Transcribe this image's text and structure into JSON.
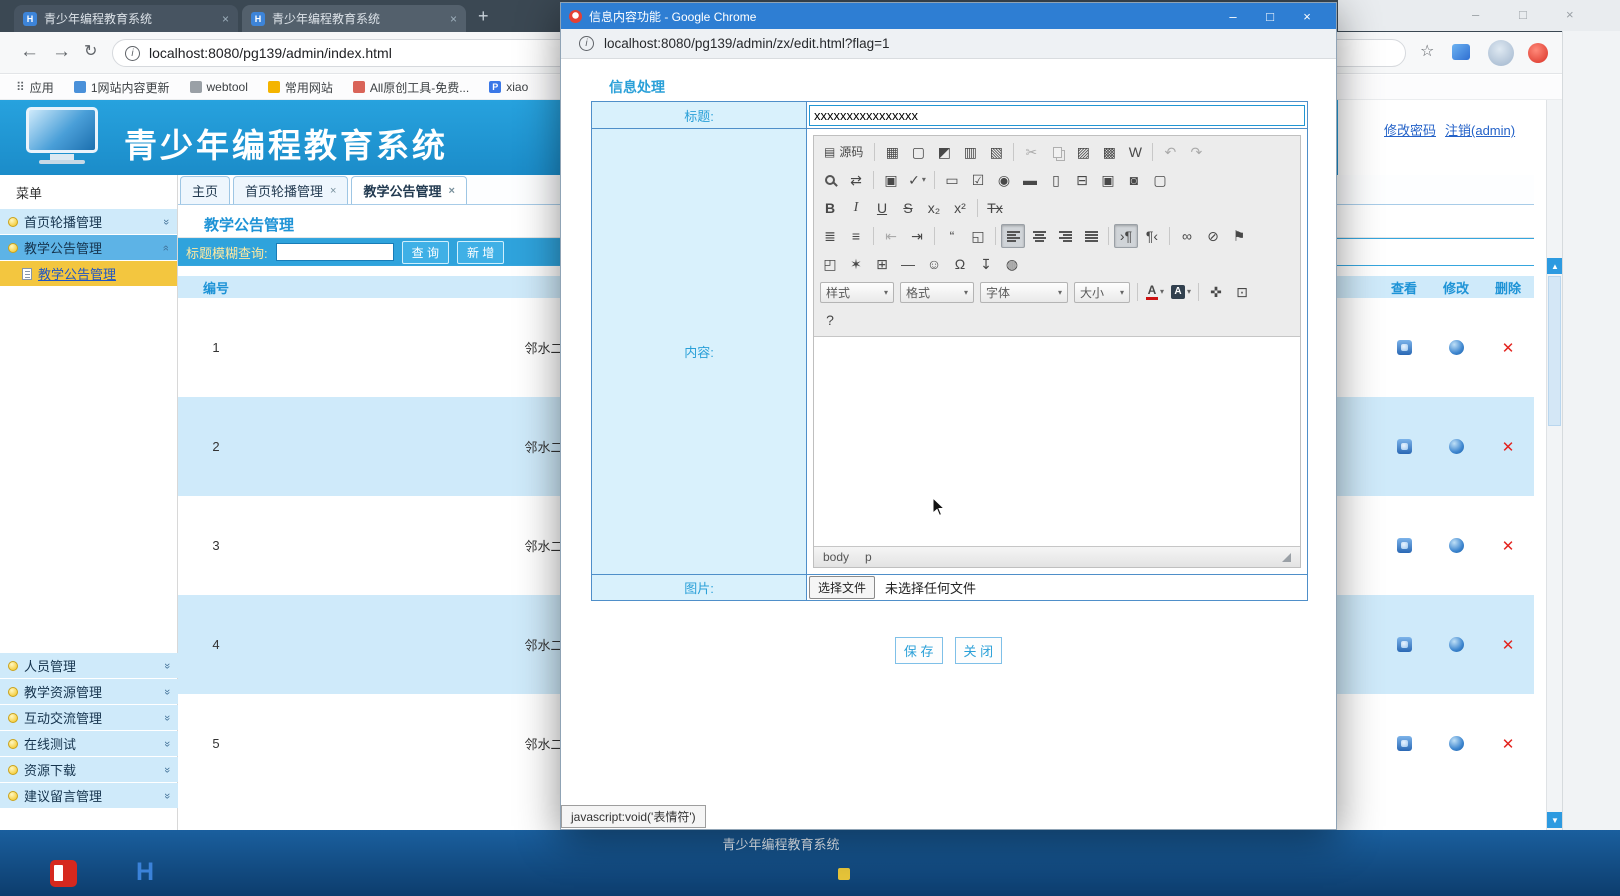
{
  "browser": {
    "tabs": [
      {
        "title": "青少年编程教育系统"
      },
      {
        "title": "青少年编程教育系统"
      }
    ],
    "address": "localhost:8080/pg139/admin/index.html",
    "bookmarks": [
      "应用",
      "1网站内容更新",
      "webtool",
      "常用网站",
      "All原创工具-免费...",
      "xiao"
    ]
  },
  "site": {
    "title": "青少年编程教育系统",
    "change_password": "修改密码",
    "logout": "注销(admin)",
    "menu_title": "菜单",
    "menu_top": [
      "首页轮播管理",
      "教学公告管理"
    ],
    "submenu": "教学公告管理",
    "menu_bottom": [
      "人员管理",
      "教学资源管理",
      "互动交流管理",
      "在线测试",
      "资源下载",
      "建议留言管理"
    ],
    "tabs": [
      "主页",
      "首页轮播管理",
      "教学公告管理"
    ],
    "panel_title": "教学公告管理",
    "search_label": "标题模糊查询:",
    "search_btn": "查 询",
    "add_btn": "新 增",
    "col_id": "编号",
    "col_title": "",
    "col_view": "查看",
    "col_edit": "修改",
    "col_delete": "删除",
    "rows": [
      {
        "id": "1",
        "title": "邻水二"
      },
      {
        "id": "2",
        "title": "邻水二"
      },
      {
        "id": "3",
        "title": "邻水二"
      },
      {
        "id": "4",
        "title": "邻水二"
      },
      {
        "id": "5",
        "title": "邻水二"
      }
    ],
    "footer": "青少年编程教育系统"
  },
  "popup": {
    "title": "信息内容功能 - Google Chrome",
    "address": "localhost:8080/pg139/admin/zx/edit.html?flag=1",
    "heading": "信息处理",
    "label_title": "标题:",
    "title_value": "xxxxxxxxxxxxxxxx",
    "label_content": "内容:",
    "label_image": "图片:",
    "file_button": "选择文件",
    "file_none": "未选择任何文件",
    "save": "保 存",
    "close_btn": "关 闭",
    "tooltip": "javascript:void('表情符')",
    "editor": {
      "source": "源码",
      "styles": "样式",
      "format": "格式",
      "font": "字体",
      "size": "大小",
      "crumb1": "body",
      "crumb2": "p"
    }
  },
  "icons": {
    "close": "×",
    "min": "–",
    "max": "□",
    "plus": "+",
    "back": "←",
    "fwd": "→",
    "reload": "↻",
    "star": "☆",
    "up": "▲",
    "down": "▼",
    "grid": "⠿",
    "h": "H",
    "p": "P",
    "delete_x": "✕",
    "chev": "»",
    "caret": "▾",
    "src": "▤",
    "save": "▦",
    "newpage": "▢",
    "preview": "◩",
    "print": "▥",
    "tpl": "▧",
    "cut": "✂",
    "paste": "▨",
    "pastetext": "▩",
    "pasteword": "W",
    "undo": "↶",
    "redo": "↷",
    "replace": "⇄",
    "selall": "▣",
    "check": "✓",
    "form": "▭",
    "checkbox": "☑",
    "radio": "◉",
    "field": "▬",
    "area": "▯",
    "select": "⊟",
    "btn": "▣",
    "imgbtn": "◙",
    "hidden": "▢",
    "b": "B",
    "i": "I",
    "u": "U",
    "s": "S",
    "sub": "x₂",
    "sup": "x²",
    "rmfmt": "Tx",
    "numlist": "≣",
    "bullist": "≡",
    "outdent": "⇤",
    "indent": "⇥",
    "quote": "“",
    "div": "◱",
    "ltr": "›¶",
    "rtl": "¶‹",
    "link": "∞",
    "unlink": "⊘",
    "anchor": "⚑",
    "img": "◰",
    "flash": "✶",
    "table": "⊞",
    "hr": "―",
    "smiley": "☺",
    "omega": "Ω",
    "pgbrk": "↧",
    "globe": "◍",
    "a": "A",
    "maxi": "✜",
    "blocks": "⊡",
    "q": "?"
  }
}
